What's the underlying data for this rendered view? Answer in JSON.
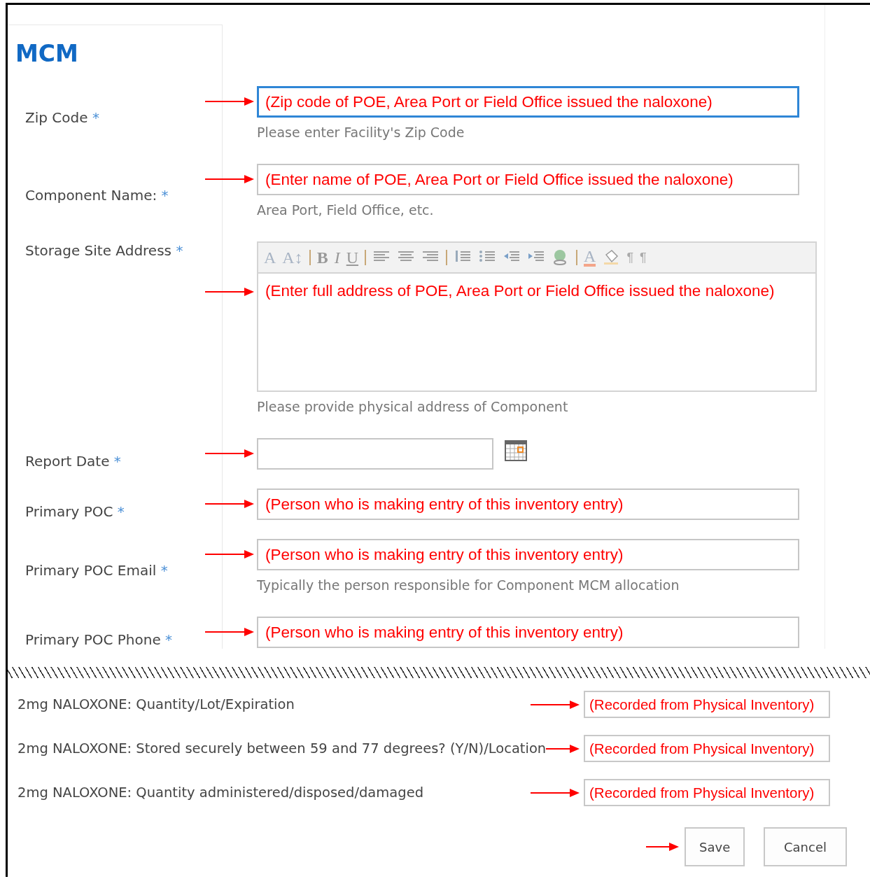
{
  "title": "MCM",
  "fields": [
    {
      "kind": "text",
      "label": "Zip Code",
      "mark": "*",
      "focused": true,
      "value": "(Zip code of POE, Area Port or Field Office issued the naloxone)",
      "hint": "Please enter Facility's Zip Code"
    },
    {
      "kind": "text",
      "label": "Component Name:",
      "mark": "*",
      "value": "(Enter name of POE, Area Port or Field Office issued the naloxone)",
      "hint": "Area Port, Field Office, etc."
    },
    {
      "kind": "richtext",
      "label": "Storage Site Address",
      "mark": "*",
      "value": "(Enter full address of POE, Area Port or Field Office issued the naloxone)",
      "hint": "Please provide physical address of Component",
      "toolbar": [
        {
          "kind": "font",
          "text": "A"
        },
        {
          "kind": "size",
          "text": "A↕"
        },
        {
          "kind": "separator"
        },
        {
          "kind": "bold",
          "text": "B"
        },
        {
          "kind": "italic",
          "text": "I"
        },
        {
          "kind": "underline",
          "text": "U"
        },
        {
          "kind": "separator"
        },
        {
          "kind": "align-left"
        },
        {
          "kind": "align-center"
        },
        {
          "kind": "align-right"
        },
        {
          "kind": "separator"
        },
        {
          "kind": "numbered"
        },
        {
          "kind": "bulleted"
        },
        {
          "kind": "outdent"
        },
        {
          "kind": "indent"
        },
        {
          "kind": "link"
        },
        {
          "kind": "separator"
        },
        {
          "kind": "font-color",
          "text": "A"
        },
        {
          "kind": "highlight"
        },
        {
          "kind": "ltr",
          "text": "¶"
        },
        {
          "kind": "rtl",
          "text": "¶"
        }
      ]
    },
    {
      "kind": "date",
      "label": "Report Date",
      "mark": "*"
    },
    {
      "kind": "text",
      "label": "Primary POC",
      "mark": "*",
      "value": "(Person who is making entry of this inventory entry)"
    },
    {
      "kind": "text",
      "label": "Primary POC Email",
      "mark": "*",
      "value": "(Person who is making entry of this inventory entry)",
      "hint": "Typically the person responsible for Component MCM allocation"
    },
    {
      "kind": "text",
      "label": "Primary POC Phone",
      "mark": "*",
      "value": "(Person who is making entry of this inventory entry)"
    }
  ],
  "inventory": [
    {
      "label": "2mg NALOXONE: Quantity/Lot/Expiration",
      "value": "(Recorded from Physical Inventory)"
    },
    {
      "label": "2mg NALOXONE: Stored securely between 59 and 77 degrees? (Y/N)/Location",
      "value": "(Recorded from Physical Inventory)"
    },
    {
      "label": "2mg NALOXONE: Quantity administered/disposed/damaged",
      "value": "(Recorded from Physical Inventory)"
    }
  ],
  "buttons": [
    {
      "label": "Save",
      "annotated": true
    },
    {
      "label": "Cancel",
      "annotated": false
    }
  ]
}
